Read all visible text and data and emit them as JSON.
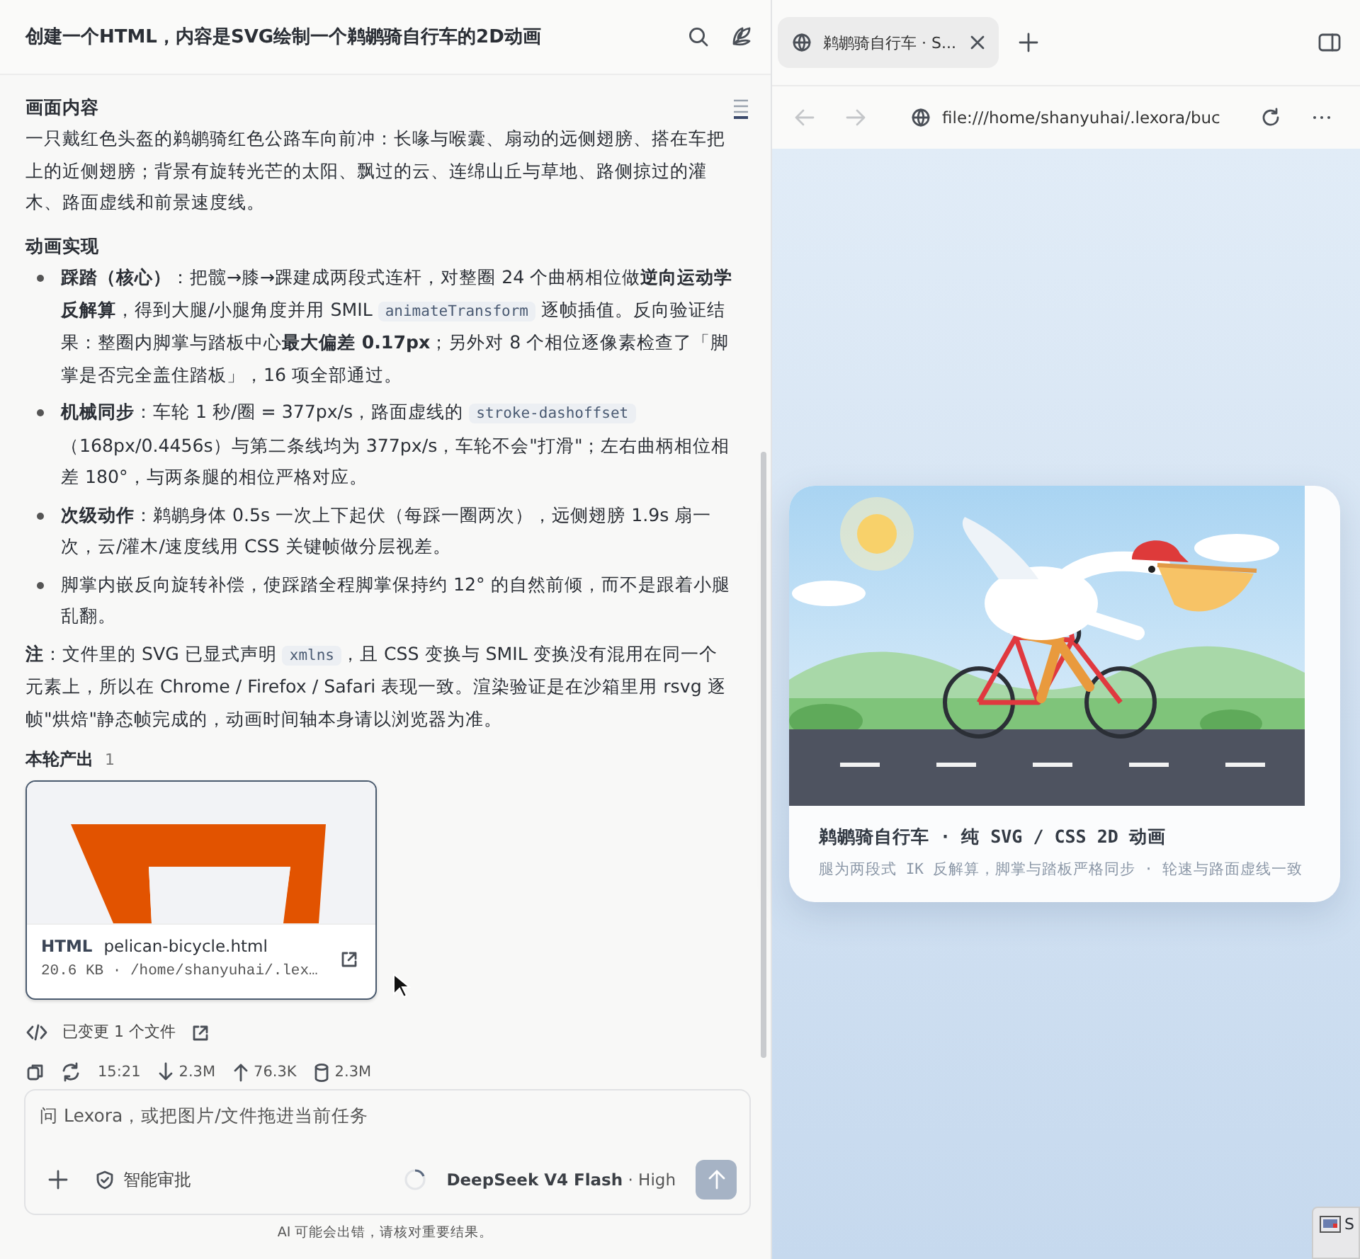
{
  "chat": {
    "title": "创建一个HTML，内容是SVG绘制一个鹈鹕骑自行车的2D动画",
    "sections": [
      {
        "kind": "heading",
        "text": "画面内容"
      },
      {
        "kind": "paragraph",
        "text": "一只戴红色头盔的鹈鹕骑红色公路车向前冲：长喙与喉囊、扇动的远侧翅膀、搭在车把上的近侧翅膀；背景有旋转光芒的太阳、飘过的云、连绵山丘与草地、路侧掠过的灌木、路面虚线和前景速度线。"
      },
      {
        "kind": "heading",
        "text": "动画实现"
      },
      {
        "kind": "bullets",
        "items": [
          [
            {
              "kind": "text",
              "text": "**踩踏（核心）**：把髋→膝→踝建成两段式连杆，对整圈 24 个曲柄相位做**逆向运动学反解算**，得到大腿/小腿角度并用 SMIL "
            },
            {
              "kind": "code",
              "text": "animateTransform"
            },
            {
              "kind": "text",
              "text": " 逐帧插值。反向验证结果：整圈内脚掌与踏板中心**最大偏差 0.17px**；另外对 8 个相位逐像素检查了「脚掌是否完全盖住踏板」，16 项全部通过。"
            }
          ],
          [
            {
              "kind": "text",
              "text": "**机械同步**：车轮 1 秒/圈 = 377px/s，路面虚线的 "
            },
            {
              "kind": "code",
              "text": "stroke-dashoffset"
            },
            {
              "kind": "text",
              "text": "（168px/0.4456s）与第二条线均为 377px/s，车轮不会\"打滑\"；左右曲柄相位相差 180°，与两条腿的相位严格对应。"
            }
          ],
          [
            {
              "kind": "text",
              "text": "**次级动作**：鹈鹕身体 0.5s 一次上下起伏（每踩一圈两次），远侧翅膀 1.9s 扇一次，云/灌木/速度线用 CSS 关键帧做分层视差。"
            }
          ],
          [
            {
              "kind": "text",
              "text": "脚掌内嵌反向旋转补偿，使踩踏全程脚掌保持约 12° 的自然前倾，而不是跟着小腿乱翻。"
            }
          ]
        ]
      },
      {
        "kind": "note",
        "segments": [
          {
            "kind": "text",
            "text": "**注**：文件里的 SVG 已显式声明 "
          },
          {
            "kind": "code",
            "text": "xmlns"
          },
          {
            "kind": "text",
            "text": "，且 CSS 变换与 SMIL 变换没有混用在同一个元素上，所以在 Chrome / Firefox / Safari 表现一致。渲染验证是在沙箱里用 rsvg 逐帧\"烘焙\"静态帧完成的，动画时间轴本身请以浏览器为准。"
          }
        ]
      }
    ],
    "outputs": {
      "label": "本轮产出",
      "count": "1",
      "file": {
        "type": "HTML",
        "name": "pelican-bicycle.html",
        "meta": "20.6 KB · /home/shanyuhai/.lex…"
      }
    },
    "changed": "已变更 1 个文件",
    "stats": {
      "time": "15:21",
      "download": "2.3M",
      "upload": "76.3K",
      "storage": "2.3M"
    },
    "composer": {
      "placeholder": "问 Lexora，或把图片/文件拖进当前任务",
      "approval": "智能审批",
      "model": "DeepSeek V4 Flash",
      "separator": "·",
      "effort": "High",
      "send_disabled": true
    },
    "disclaimer": "AI 可能会出错，请核对重要结果。"
  },
  "browser": {
    "tabs": [
      {
        "title": "鹈鹕骑自行车 · S...",
        "selected": true
      }
    ],
    "back_disabled": true,
    "forward_disabled": true,
    "url": "file:///home/shanyuhai/.lexora/buc",
    "card": {
      "title": "鹈鹕骑自行车 · 纯 SVG / CSS 2D 动画",
      "subtitle": "腿为两段式 IK 反解算，脚掌与踏板严格同步 · 轮速与路面虚线一致"
    }
  },
  "taskbar": {
    "label": "S"
  }
}
